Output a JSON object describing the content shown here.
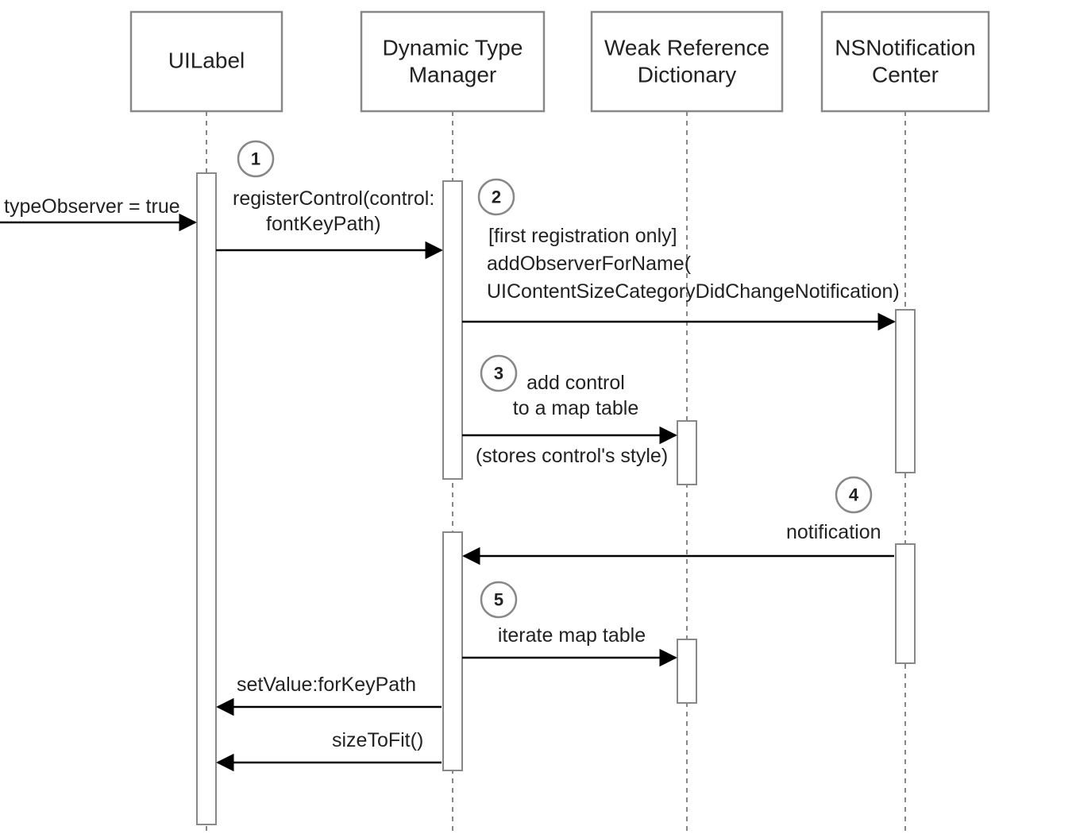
{
  "participants": {
    "p1": {
      "name": "UILabel"
    },
    "p2": {
      "line1": "Dynamic Type",
      "line2": "Manager"
    },
    "p3": {
      "line1": "Weak Reference",
      "line2": "Dictionary"
    },
    "p4": {
      "line1": "NSNotification",
      "line2": "Center"
    }
  },
  "steps": {
    "s1": "1",
    "s2": "2",
    "s3": "3",
    "s4": "4",
    "s5": "5"
  },
  "messages": {
    "m0": "typeObserver = true",
    "m1_l1": "registerControl(control:",
    "m1_l2": "fontKeyPath)",
    "m2_l1": "[first registration only]",
    "m2_l2": "addObserverForName(",
    "m2_l3": "UIContentSizeCategoryDidChangeNotification)",
    "m3_l1": "add control",
    "m3_l2": "to a map table",
    "m3_l3": "(stores control's style)",
    "m4": "notification",
    "m5": "iterate map table",
    "m6": "setValue:forKeyPath",
    "m7": "sizeToFit()"
  }
}
